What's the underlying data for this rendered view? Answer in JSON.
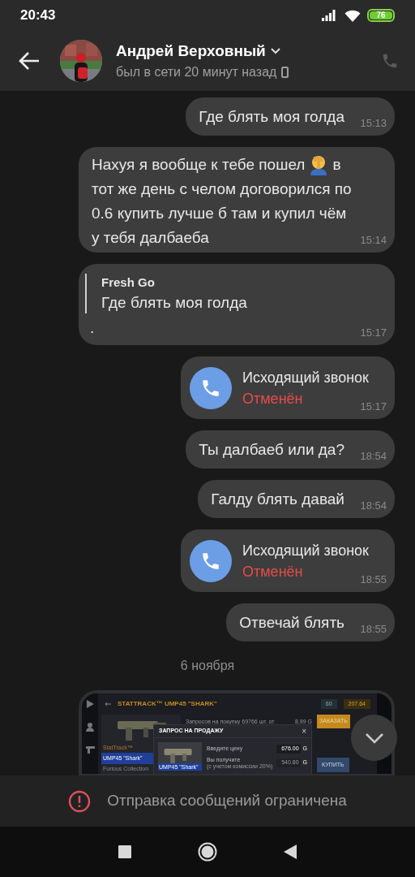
{
  "status_bar": {
    "time": "20:43",
    "battery": "76"
  },
  "header": {
    "name": "Андрей Верховный",
    "status": "был в сети 20 минут назад"
  },
  "messages": [
    {
      "kind": "text",
      "outgoing": true,
      "text": "Где блять моя голда",
      "time": "15:13"
    },
    {
      "kind": "parts",
      "parts": [
        {
          "kind": "text",
          "text": "Нахуя я вообще к тебе пошел"
        },
        {
          "kind": "emoji"
        },
        {
          "kind": "text",
          "text": "в"
        },
        {
          "kind": "block",
          "text": "тот же день с челом договорился по 0.6 купить лучше б там и купил чём у тебя далбаеба"
        }
      ],
      "time": "15:14"
    },
    {
      "kind": "reply",
      "quote_author": "Fresh Go",
      "quote_text": "Где блять моя голда",
      "text": ".",
      "time": "15:17"
    },
    {
      "kind": "call",
      "outgoing": true,
      "title": "Исходящий звонок",
      "status": "Отменён",
      "cancelled": true,
      "time": "15:17"
    },
    {
      "kind": "text",
      "outgoing": true,
      "text": "Ты далбаеб или да?",
      "time": "18:54"
    },
    {
      "kind": "text",
      "outgoing": true,
      "text": "Галду блять давай",
      "time": "18:54"
    },
    {
      "kind": "call",
      "outgoing": true,
      "title": "Исходящий звонок",
      "status": "Отменён",
      "cancelled": true,
      "time": "18:55"
    },
    {
      "kind": "text",
      "outgoing": true,
      "text": "Отвечай блять",
      "time": "18:55"
    },
    {
      "kind": "date",
      "text": "6 ноября"
    },
    {
      "kind": "screenshot",
      "title": "STATTRACK™ UMP45 \"SHARK\"",
      "chips": [
        "60",
        "207.64"
      ],
      "card_tag": "StatTrack™",
      "card_name": "UMP45 \"Shark\"",
      "card_collection": "Furious Collection",
      "offers": "Запросов на покупку 69766 шт. от",
      "offers_price": "8.99 G",
      "order_button": "ЗАКАЗАТЬ",
      "buy_button": "КУПИТЬ",
      "modal": {
        "title": "ЗАПРОС НА ПРОДАЖУ",
        "close": "×",
        "item": "UMP45 \"Shark\"",
        "price_label": "Введите цену",
        "price": "676.00",
        "currency": "G",
        "receive_label": "Вы получите",
        "receive_note": "(с учетом комиссии 20%)",
        "receive": "540.80",
        "receive_currency": "G"
      }
    }
  ],
  "restriction": {
    "text": "Отправка сообщений ограничена"
  }
}
